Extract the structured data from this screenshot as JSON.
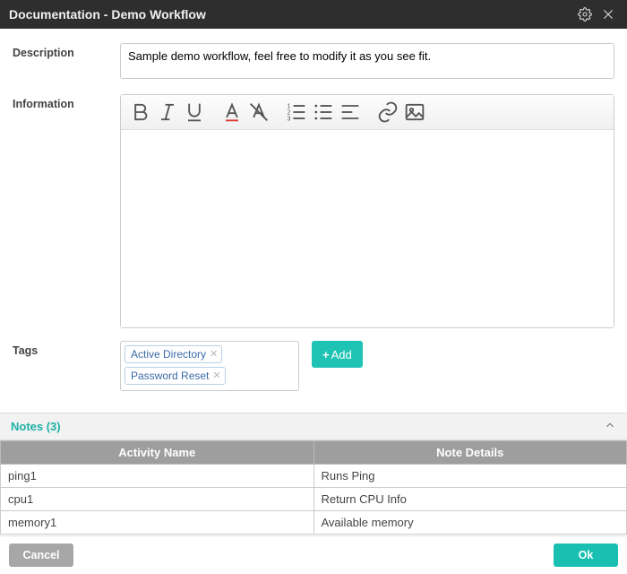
{
  "titlebar": {
    "title": "Documentation - Demo Workflow"
  },
  "labels": {
    "description": "Description",
    "information": "Information",
    "tags": "Tags"
  },
  "description": {
    "value": "Sample demo workflow, feel free to modify it as you see fit."
  },
  "tags": {
    "items": [
      {
        "label": "Active Directory"
      },
      {
        "label": "Password Reset"
      }
    ],
    "add_label": "Add"
  },
  "notes": {
    "header_label": "Notes (3)",
    "columns": {
      "activity": "Activity Name",
      "details": "Note Details"
    },
    "rows": [
      {
        "activity": "ping1",
        "details": "Runs Ping"
      },
      {
        "activity": "cpu1",
        "details": "Return CPU Info"
      },
      {
        "activity": "memory1",
        "details": "Available memory"
      }
    ]
  },
  "footer": {
    "cancel": "Cancel",
    "ok": "Ok"
  }
}
